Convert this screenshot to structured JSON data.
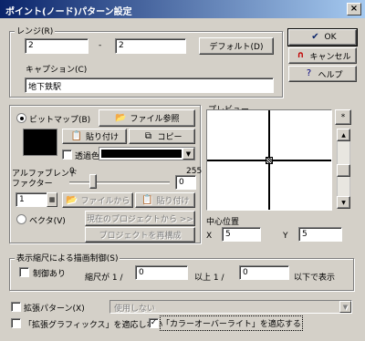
{
  "window": {
    "title": "ポイント(ノード)パターン設定",
    "close_glyph": "×"
  },
  "range": {
    "group_label": "レンジ(R)",
    "from_value": "2",
    "separator": "-",
    "to_value": "2",
    "default_button": "デフォルト(D)"
  },
  "caption": {
    "label": "キャプション(C)",
    "value": "地下鉄駅"
  },
  "dialog_buttons": {
    "ok": "OK",
    "cancel": "キャンセル",
    "help": "ヘルプ"
  },
  "source": {
    "bitmap_radio": "ビットマップ(B)",
    "file_browse": "ファイル参照",
    "paste": "貼り付け",
    "copy": "コピー",
    "transparent_color": "透過色",
    "alpha_blend_label": "アルファブレンド",
    "alpha_factor_label": "ファクター",
    "alpha_min": "0",
    "alpha_max": "255",
    "alpha_value": "0",
    "scale_value": "1",
    "from_file": "ファイルから",
    "paste_disabled": "貼り付け",
    "vector_radio": "ベクタ(V)",
    "from_current_project": "現在のプロジェクトから >>",
    "reconfigure_project": "プロジェクトを再構成"
  },
  "preview": {
    "label": "プレビュー",
    "star_button": "*",
    "center_label": "中心位置",
    "x_label": "X",
    "x_value": "5",
    "y_label": "Y",
    "y_value": "5"
  },
  "scale_control": {
    "group_label": "表示縮尺による描画制御(S)",
    "control_checkbox": "制御あり",
    "scale_prefix": "縮尺が 1 /",
    "min_value": "0",
    "mid_text": "以上 1 /",
    "max_value": "0",
    "suffix": "以下で表示"
  },
  "bottom": {
    "extended_pattern": "拡張パターン(X)",
    "extended_select": "使用しない",
    "no_extended_graphics": "「拡張グラフィックス」を適応しない",
    "apply_color_overlay": "「カラーオーバーライト」を適応する",
    "apply_color_overlay_checked": true
  },
  "colors": {
    "swatch": "#000000",
    "titlebar_start": "#0a246a",
    "titlebar_end": "#a6caf0"
  }
}
